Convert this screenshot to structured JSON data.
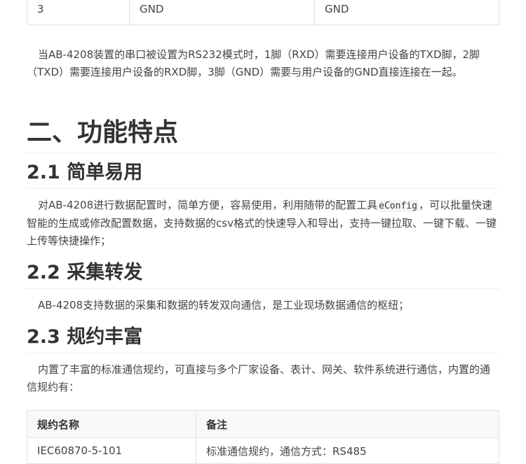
{
  "top_table": {
    "row": [
      "3",
      "GND",
      "GND"
    ]
  },
  "para_rs232": "当AB-4208装置的串口被设置为RS232模式时，1脚（RXD）需要连接用户设备的TXD脚，2脚（TXD）需要连接用户设备的RXD脚，3脚（GND）需要与用户设备的GND直接连接在一起。",
  "section2": {
    "title": "二、功能特点",
    "s21": {
      "title": "2.1 简单易用",
      "text_before": "对AB-4208进行数据配置时，简单方便，容易使用，利用随带的配置工具",
      "code": "eConfig",
      "text_after": "，可以批量快速智能的生成或修改配置数据，支持数据的csv格式的快速导入和导出，支持一键拉取、一键下载、一键上传等快捷操作；"
    },
    "s22": {
      "title": "2.2 采集转发",
      "text": "AB-4208支持数据的采集和数据的转发双向通信，是工业现场数据通信的枢纽；"
    },
    "s23": {
      "title": "2.3 规约丰富",
      "text": "内置了丰富的标准通信规约，可直接与多个厂家设备、表计、网关、软件系统进行通信，内置的通信规约有："
    }
  },
  "protocol_table": {
    "headers": [
      "规约名称",
      "备注"
    ],
    "rows": [
      [
        "IEC60870-5-101",
        "标准通信规约，通信方式：RS485"
      ]
    ]
  }
}
